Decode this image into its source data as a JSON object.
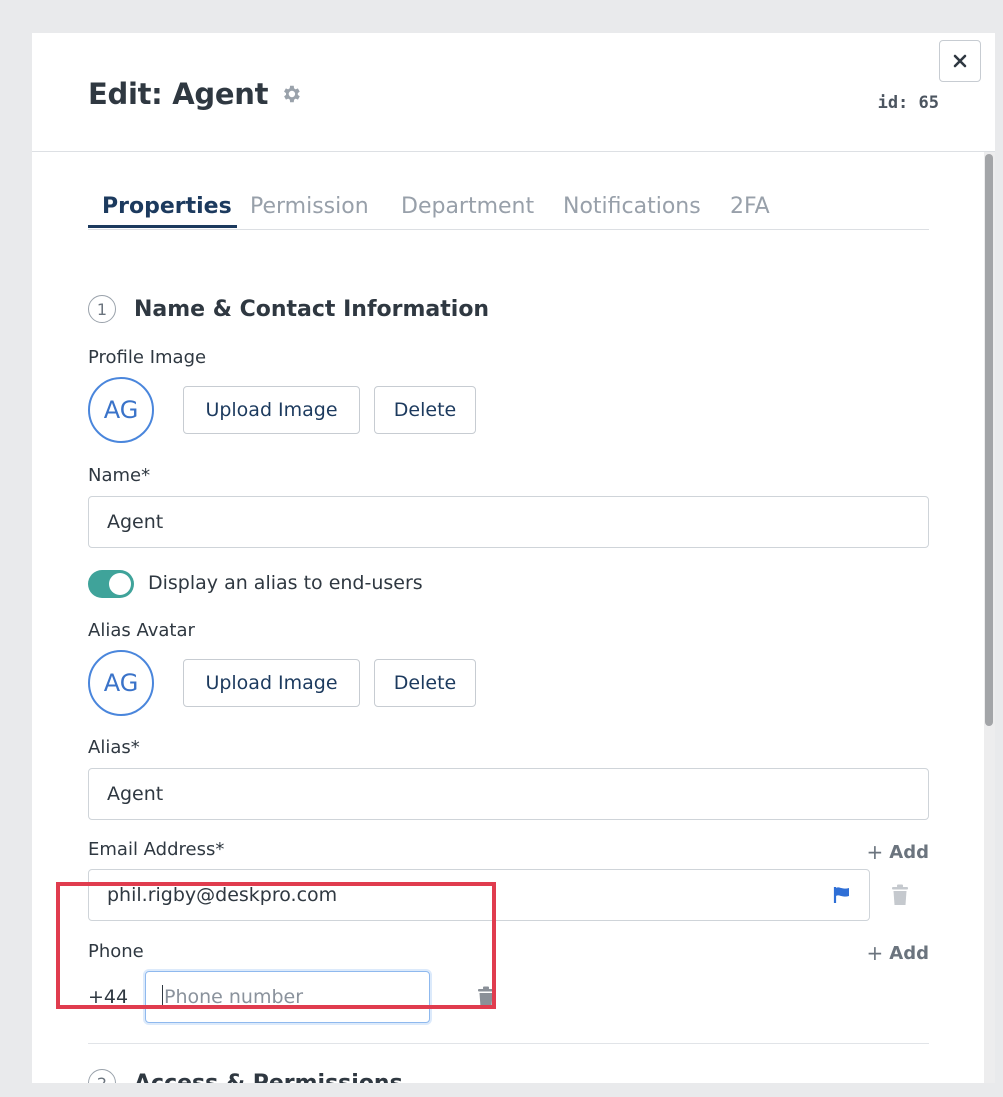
{
  "header": {
    "title": "Edit: Agent",
    "id_label": "id: 65"
  },
  "tabs": [
    {
      "label": "Properties",
      "active": true
    },
    {
      "label": "Permission",
      "active": false
    },
    {
      "label": "Department",
      "active": false
    },
    {
      "label": "Notifications",
      "active": false
    },
    {
      "label": "2FA",
      "active": false
    }
  ],
  "sections": [
    {
      "number": "1",
      "title": "Name & Contact Information"
    },
    {
      "number": "2",
      "title": "Access & Permissions"
    }
  ],
  "profile_image": {
    "label": "Profile Image",
    "initials": "AG",
    "upload_label": "Upload Image",
    "delete_label": "Delete"
  },
  "name": {
    "label": "Name*",
    "value": "Agent"
  },
  "alias_toggle": {
    "label": "Display an alias to end-users",
    "enabled": true
  },
  "alias_avatar": {
    "label": "Alias Avatar",
    "initials": "AG",
    "upload_label": "Upload Image",
    "delete_label": "Delete"
  },
  "alias": {
    "label": "Alias*",
    "value": "Agent"
  },
  "email": {
    "label": "Email Address*",
    "add_label": "Add",
    "value": "phil.rigby@deskpro.com"
  },
  "phone": {
    "label": "Phone",
    "add_label": "Add",
    "country_code": "+44",
    "placeholder": "Phone number"
  },
  "colors": {
    "accent": "#1c3a5e",
    "toggle_on": "#3fa39a",
    "avatar_border": "#4a86dc",
    "highlight": "#e03c4e",
    "flag": "#2f6fd6"
  }
}
